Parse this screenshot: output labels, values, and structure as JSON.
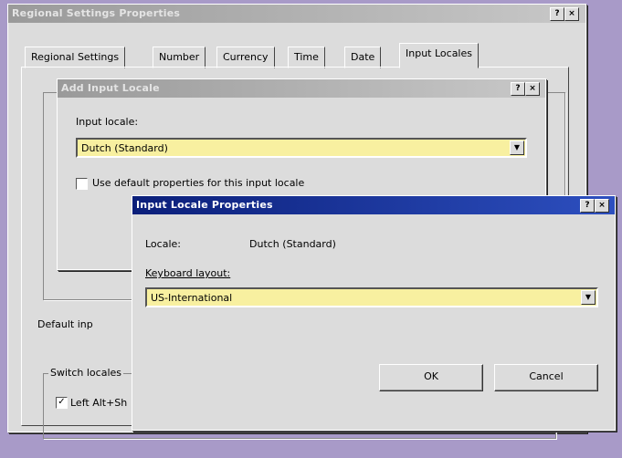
{
  "regional": {
    "title": "Regional Settings Properties",
    "title_buttons": [
      "?",
      "×"
    ],
    "tabs": [
      "Regional Settings",
      "Number",
      "Currency",
      "Time",
      "Date",
      "Input Locales"
    ],
    "default_label": "Default inp",
    "switch_group_label": "Switch locales",
    "switch_option": "Left Alt+Sh"
  },
  "add_dialog": {
    "title": "Add Input Locale",
    "title_buttons": [
      "?",
      "×"
    ],
    "input_locale_label": "Input locale:",
    "input_locale_value": "Dutch (Standard)",
    "checkbox_label": "Use default properties for this input locale",
    "checkbox_checked": false
  },
  "props_dialog": {
    "title": "Input Locale Properties",
    "title_buttons": [
      "?",
      "×"
    ],
    "locale_label": "Locale:",
    "locale_value": "Dutch (Standard)",
    "layout_label": "Keyboard layout:",
    "layout_value": "US-International",
    "ok_label": "OK",
    "cancel_label": "Cancel"
  }
}
